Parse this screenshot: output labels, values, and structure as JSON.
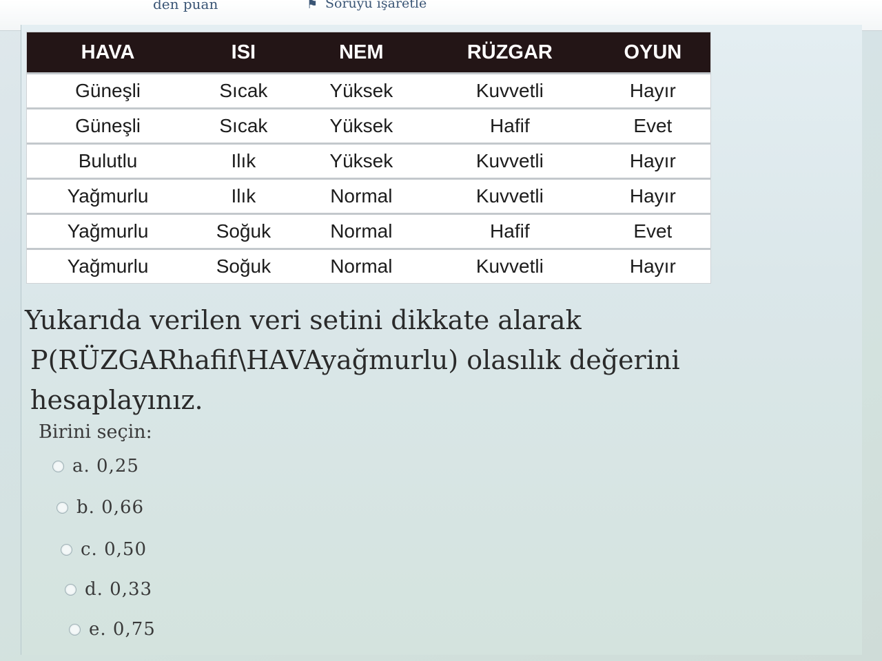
{
  "header": {
    "cut_text": "den puan",
    "flag_label": "Soruyu işaretle"
  },
  "table": {
    "headers": [
      "HAVA",
      "ISI",
      "NEM",
      "RÜZGAR",
      "OYUN"
    ],
    "rows": [
      [
        "Güneşli",
        "Sıcak",
        "Yüksek",
        "Kuvvetli",
        "Hayır"
      ],
      [
        "Güneşli",
        "Sıcak",
        "Yüksek",
        "Hafif",
        "Evet"
      ],
      [
        "Bulutlu",
        "Ilık",
        "Yüksek",
        "Kuvvetli",
        "Hayır"
      ],
      [
        "Yağmurlu",
        "Ilık",
        "Normal",
        "Kuvvetli",
        "Hayır"
      ],
      [
        "Yağmurlu",
        "Soğuk",
        "Normal",
        "Hafif",
        "Evet"
      ],
      [
        "Yağmurlu",
        "Soğuk",
        "Normal",
        "Kuvvetli",
        "Hayır"
      ]
    ]
  },
  "question": {
    "line1": "Yukarıda verilen veri setini dikkate alarak",
    "line2": "P(RÜZGARhafif\\HAVAyağmurlu) olasılık değerini hesaplayınız."
  },
  "answer": {
    "prompt": "Birini seçin:",
    "options": [
      {
        "label": "a. 0,25",
        "selected": false
      },
      {
        "label": "b. 0,66",
        "selected": false
      },
      {
        "label": "c. 0,50",
        "selected": false
      },
      {
        "label": "d. 0,33",
        "selected": false
      },
      {
        "label": "e. 0,75",
        "selected": false
      }
    ]
  }
}
